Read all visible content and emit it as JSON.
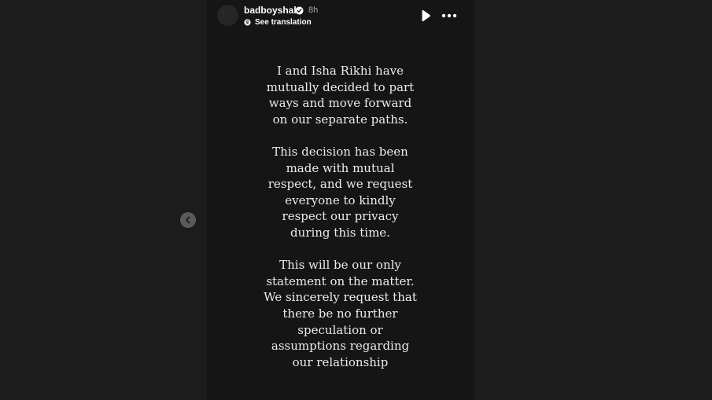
{
  "header": {
    "username": "badboyshah",
    "time": "8h",
    "avatar_text": "˙ ˙",
    "see_translation": "See translation"
  },
  "icons": {
    "verified": "verified-badge-icon",
    "translate": "globe-icon",
    "play": "play-icon",
    "more": "more-options-icon",
    "prev": "chevron-left-icon"
  },
  "story": {
    "paragraph_1": "I and Isha Rikhi have\nmutually decided to part\nways and move forward\non our separate paths.",
    "paragraph_2": "This decision has been\nmade with mutual\nrespect, and we request\neveryone to kindly\nrespect our privacy\nduring this time.",
    "paragraph_3": "This will be our only\nstatement on the matter.\nWe sincerely request that\nthere be no further\nspeculation or\nassumptions regarding\nour relationship"
  },
  "colors": {
    "background": "#1c1c1c",
    "story_background": "#151515",
    "text": "#ececec",
    "verified": "#ffffff"
  }
}
